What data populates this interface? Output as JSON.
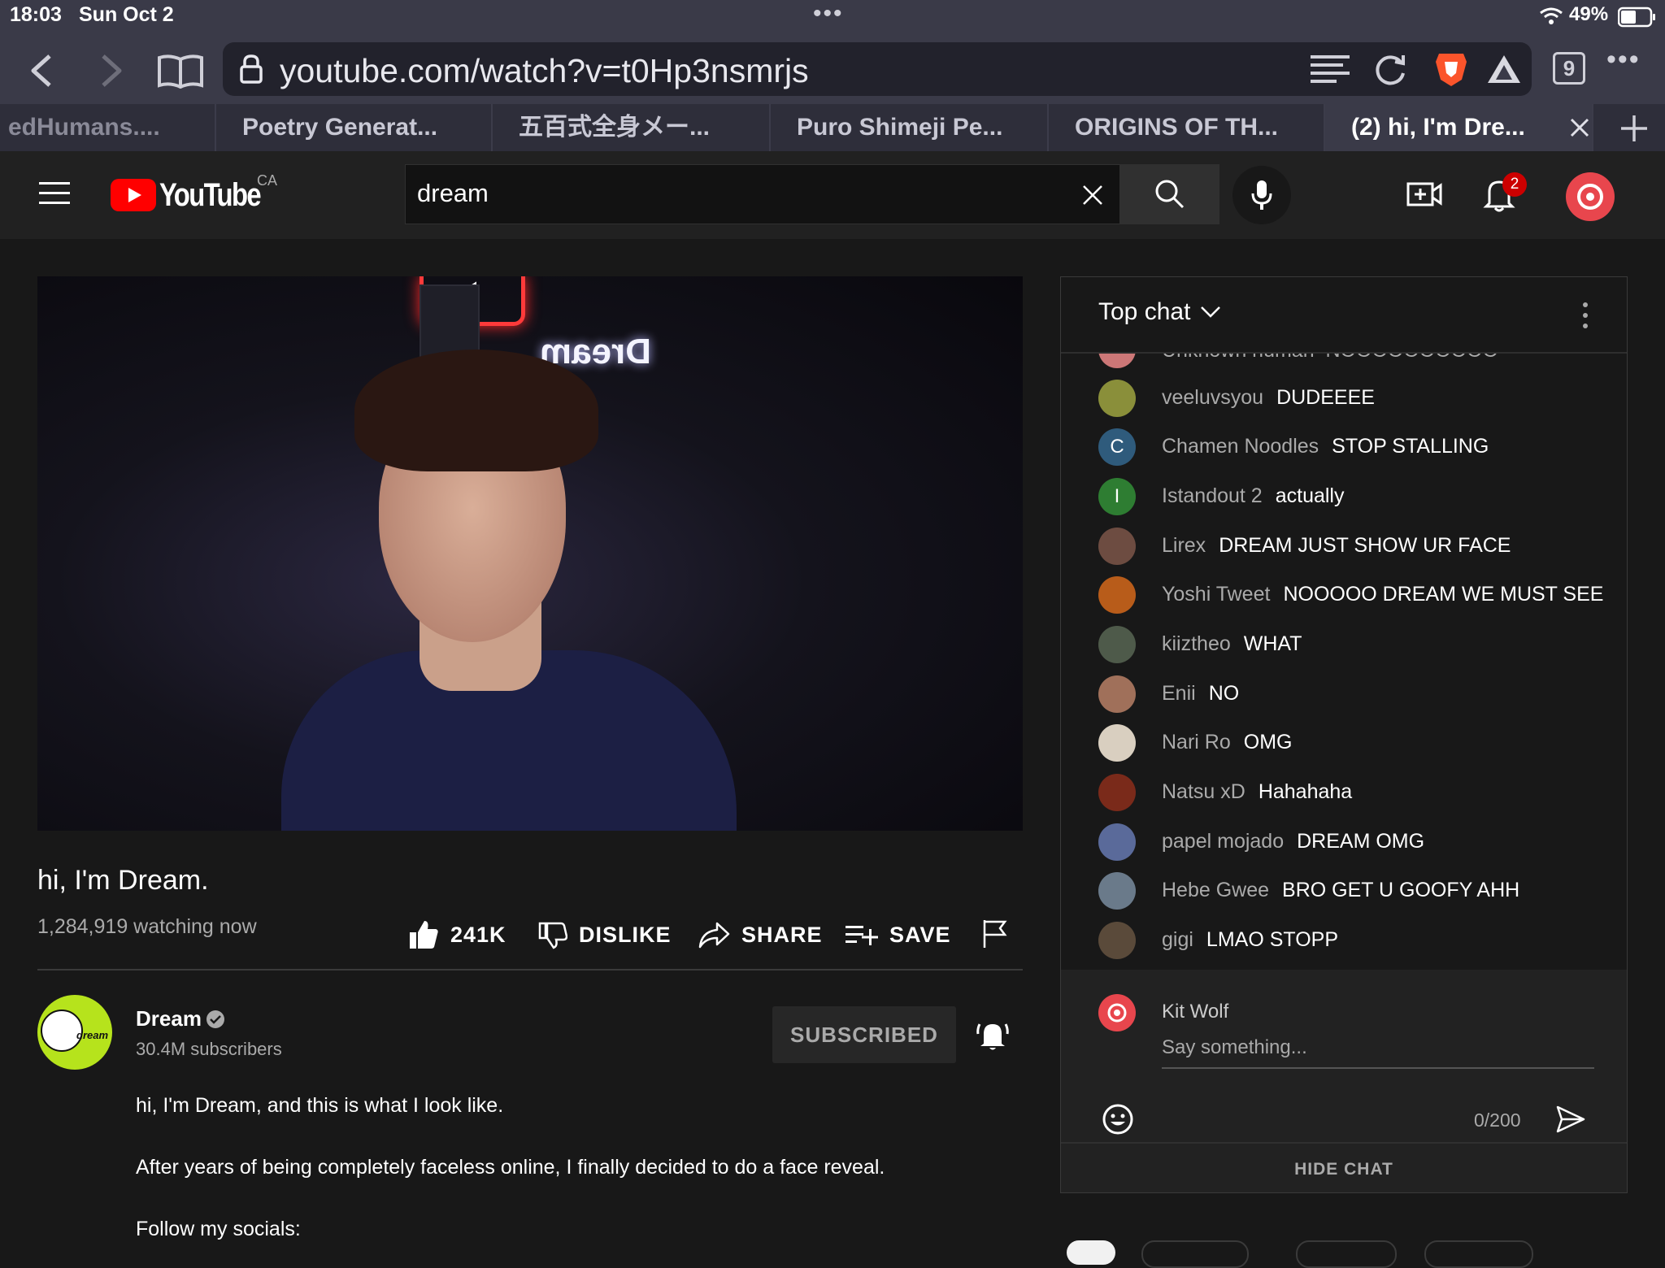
{
  "status_bar": {
    "time": "18:03",
    "date": "Sun Oct 2",
    "battery": "49%"
  },
  "browser": {
    "url": "youtube.com/watch?v=t0Hp3nsmrjs",
    "tab_count": "9",
    "tabs": [
      {
        "label": "edHumans...."
      },
      {
        "label": "Poetry Generat..."
      },
      {
        "label": "五百式全身メー..."
      },
      {
        "label": "Puro Shimeji Pe..."
      },
      {
        "label": "ORIGINS OF TH..."
      },
      {
        "label": "(2) hi, I'm Dre..."
      }
    ]
  },
  "youtube": {
    "logo_text": "YouTube",
    "region": "CA",
    "search_value": "dream",
    "notification_count": "2"
  },
  "video": {
    "sign_text": "Dream",
    "title": "hi, I'm Dream.",
    "watching": "1,284,919 watching now",
    "actions": {
      "likes": "241K",
      "dislike": "DISLIKE",
      "share": "SHARE",
      "save": "SAVE"
    }
  },
  "channel": {
    "name": "Dream",
    "subscribers": "30.4M subscribers",
    "avatar_text": "dream",
    "subscribe_label": "SUBSCRIBED"
  },
  "description": [
    "hi, I'm Dream, and this is what I look like.",
    "After years of being completely faceless online, I finally decided to do a face reveal.",
    "Follow my socials:"
  ],
  "chat": {
    "header": "Top chat",
    "clipped_message": "Unknown human  NOOOOOOOOOO",
    "messages": [
      {
        "author": "veeluvsyou",
        "text": "DUDEEEE",
        "color": "#8a8f3a"
      },
      {
        "author": "Chamen Noodles",
        "text": "STOP STALLING",
        "initial": "C",
        "color": "#2f5b7c"
      },
      {
        "author": "Istandout 2",
        "text": "actually",
        "initial": "I",
        "color": "#2e7d32"
      },
      {
        "author": "Lirex",
        "text": "DREAM JUST SHOW UR FACE",
        "color": "#6d4c41"
      },
      {
        "author": "Yoshi Tweet",
        "text": "NOOOOO DREAM WE MUST SEE",
        "color": "#b85c1a"
      },
      {
        "author": "kiiztheo",
        "text": "WHAT",
        "color": "#4e5a4a"
      },
      {
        "author": "Enii",
        "text": "NO",
        "color": "#a0705a"
      },
      {
        "author": "Nari Ro",
        "text": "OMG",
        "color": "#d9cfc0"
      },
      {
        "author": "Natsu xD",
        "text": "Hahahaha",
        "color": "#7a2a1a"
      },
      {
        "author": "papel mojado",
        "text": "DREAM OMG",
        "color": "#5a6a9a"
      },
      {
        "author": "Hebe Gwee",
        "text": "BRO GET U GOOFY AHH",
        "color": "#6a7a8a"
      },
      {
        "author": "gigi",
        "text": "LMAO STOPP",
        "color": "#5a4a3a"
      }
    ],
    "input_user": "Kit Wolf",
    "input_placeholder": "Say something...",
    "char_count": "0/200",
    "hide_label": "HIDE CHAT"
  }
}
